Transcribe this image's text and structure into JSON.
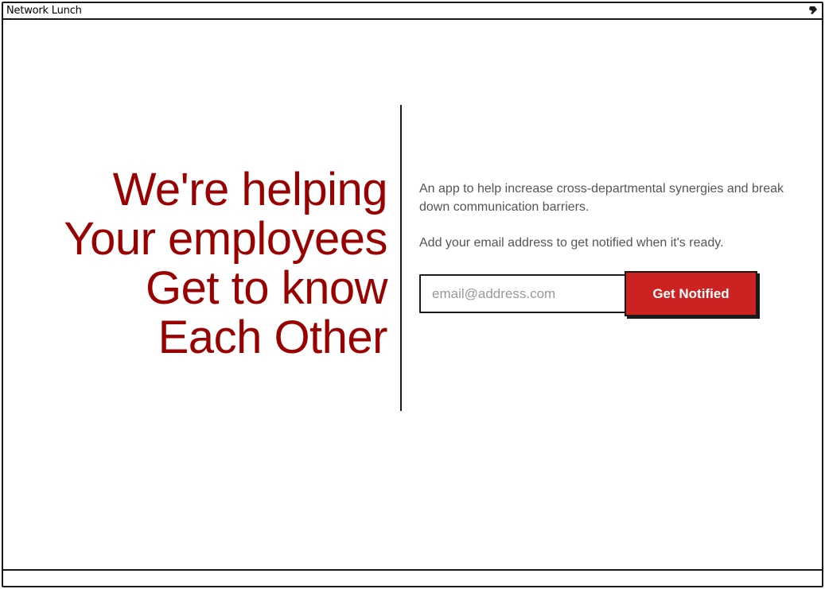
{
  "window": {
    "title": "Network Lunch",
    "pin_icon": "pin-icon"
  },
  "hero": {
    "headline_lines": [
      "We're helping",
      "Your employees",
      "Get to know",
      "Each Other"
    ],
    "headline_color": "#990000"
  },
  "signup": {
    "tagline": "An app to help increase cross-departmental synergies and break down communication barriers.",
    "cta_text": "Add your email address to get notified when it's ready.",
    "email_placeholder": "email@address.com",
    "email_value": "",
    "button_label": "Get Notified",
    "button_color": "#cc2222"
  }
}
